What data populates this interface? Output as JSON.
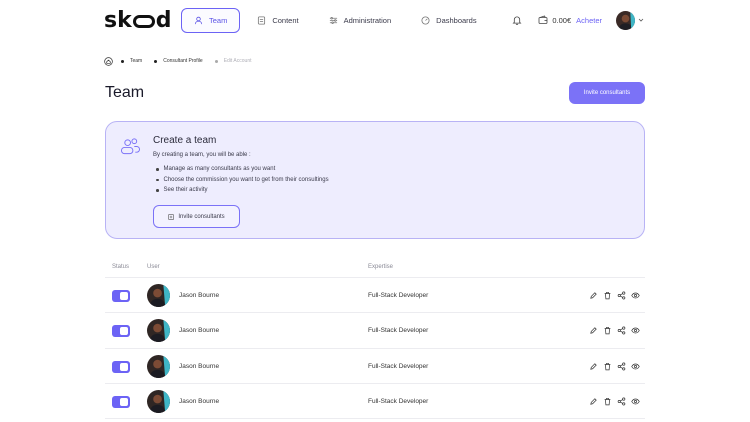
{
  "brand": {
    "logo_left": "sk",
    "logo_right": "d"
  },
  "nav": [
    {
      "label": "Team",
      "icon": "team-icon",
      "active": true
    },
    {
      "label": "Content",
      "icon": "content-icon",
      "active": false
    },
    {
      "label": "Administration",
      "icon": "administration-icon",
      "active": false
    },
    {
      "label": "Dashboards",
      "icon": "dashboards-icon",
      "active": false
    }
  ],
  "header": {
    "balance": "0.00€",
    "buy_label": "Acheter"
  },
  "breadcrumb": [
    "Team",
    "Consultant Profile",
    "Edit Account"
  ],
  "page": {
    "title": "Team",
    "invite_button": "Invite consultants"
  },
  "card": {
    "title": "Create a team",
    "subtitle": "By creating a team, you will be able :",
    "items": [
      "Manage as many consultants as you want",
      "Choose the commission you want to get from their consultings",
      "See their activity"
    ],
    "button": "Invite consultants"
  },
  "table": {
    "headers": {
      "status": "Status",
      "user": "User",
      "expertise": "Expertise"
    },
    "rows": [
      {
        "name": "Jason Bourne",
        "expertise": "Full-Stack Developer",
        "active": true
      },
      {
        "name": "Jason Bourne",
        "expertise": "Full-Stack Developer",
        "active": true
      },
      {
        "name": "Jason Bourne",
        "expertise": "Full-Stack Developer",
        "active": true
      },
      {
        "name": "Jason Bourne",
        "expertise": "Full-Stack Developer",
        "active": true
      }
    ]
  },
  "colors": {
    "accent": "#6c63f5",
    "card_bg": "#eeedfe",
    "card_border": "#b8b3f5"
  }
}
